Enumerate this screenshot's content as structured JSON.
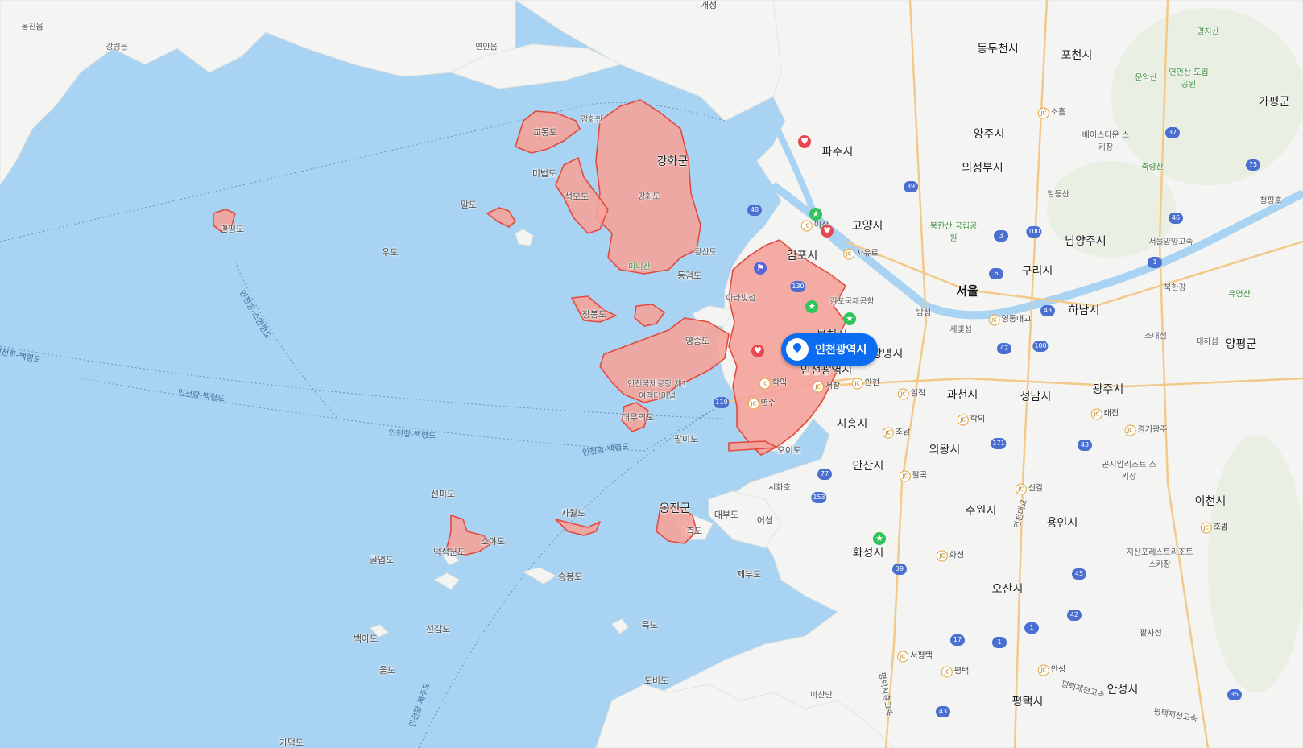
{
  "map": {
    "selected_region": "인천광역시",
    "colors": {
      "sea": "#a9d3f2",
      "land": "#f4f4f2",
      "region_fill": "#f4a39a",
      "region_stroke": "#e24a3f",
      "badge": "#0a6cf0"
    },
    "labels": {
      "l0": "개성",
      "l1": "옹진읍",
      "l2": "강령읍",
      "l3": "연안읍",
      "l4": "강화만",
      "l5": "교동도",
      "l6": "강화군",
      "l7": "강화도",
      "l8": "미법도",
      "l9": "석모도",
      "l10": "말도",
      "l11": "마니산",
      "l12": "황산도",
      "l13": "동검도",
      "l14": "우도",
      "l15": "연평도",
      "l16": "인천항-소연평도",
      "l17": "인천항-백령도",
      "l18": "인천항-백령도",
      "l19": "인천항-백령도",
      "l20": "인천항-백령도",
      "l21": "영종도",
      "l22": "장봉도",
      "l23": "인천국제공항 제1여객터미널",
      "l24": "대무의도",
      "l25": "팔미도",
      "l26": "선미도",
      "l27": "덕적군도",
      "l28": "소야도",
      "l29": "굴업도",
      "l30": "자월도",
      "l31": "옹진군",
      "l32": "대부도",
      "l33": "어섬",
      "l34": "측도",
      "l35": "승봉도",
      "l36": "제부도",
      "l37": "선갑도",
      "l38": "백아도",
      "l39": "울도",
      "l40": "육도",
      "l41": "도비도",
      "l42": "가덕도",
      "l43": "인천항-제주도",
      "l44": "아라빛섬",
      "l45": "김포국제공항",
      "l46": "김포시",
      "l47": "오이도",
      "l48": "시화호",
      "l49": "인천광역시",
      "l50": "부천시",
      "l51": "광명시",
      "l52": "시흥시",
      "l53": "안산시",
      "l54": "화성시",
      "l55": "파주시",
      "l56": "고양시",
      "l57": "양주시",
      "l58": "의정부시",
      "l59": "동두천시",
      "l60": "포천시",
      "l61": "북한산 국립공원",
      "l62": "서울",
      "l63": "남양주시",
      "l64": "구리시",
      "l65": "하남시",
      "l66": "과천시",
      "l67": "의왕시",
      "l68": "성남시",
      "l69": "광주시",
      "l70": "수원시",
      "l71": "용인시",
      "l72": "오산시",
      "l73": "평택시",
      "l74": "안성시",
      "l75": "이천시",
      "l76": "양평군",
      "l77": "가평군",
      "l78": "명지산",
      "l79": "운악산",
      "l80": "연인산 도립공원",
      "l81": "축령산",
      "l82": "유명산",
      "l83": "베어스타운 스키장",
      "l84": "곤지암리조트 스키장",
      "l85": "지산포레스트리조트 스키장",
      "l86": "팔자성",
      "l87": "세빛섬",
      "l88": "밤섬",
      "l89": "아산만",
      "l90": "알등산",
      "l91": "청평호",
      "l92": "북한강",
      "l93": "대하섬",
      "l94": "소내섬",
      "l95": "서울양양고속",
      "l96": "평택제천고속",
      "l97": "평택제천고속",
      "l98": "평택시흥고속",
      "l99": "인천대교",
      "l100": "학익",
      "l101": "연수"
    },
    "routes": [
      "39",
      "48",
      "130",
      "110",
      "77",
      "153",
      "39",
      "1",
      "17",
      "1",
      "100",
      "3",
      "6",
      "43",
      "47",
      "100",
      "171",
      "43",
      "45",
      "1",
      "35",
      "42",
      "46",
      "37",
      "75",
      "45",
      "43"
    ],
    "junctions": [
      "소흘",
      "자유로",
      "이산",
      "영동대교",
      "일직",
      "학의",
      "조남",
      "팔곡",
      "신갈",
      "화성",
      "서평택",
      "평택",
      "안성",
      "안현",
      "서창",
      "태전",
      "경기광주",
      "호법"
    ],
    "poi_icons": [
      "heart",
      "star",
      "heart",
      "star",
      "star",
      "flag",
      "heart",
      "star"
    ]
  }
}
